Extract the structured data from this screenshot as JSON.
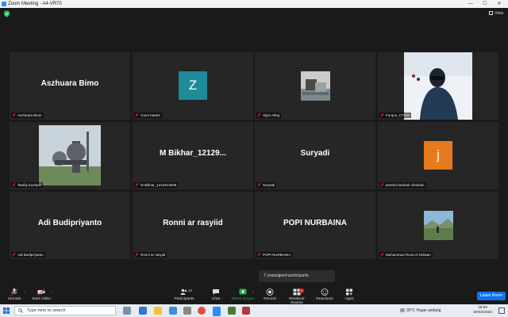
{
  "window": {
    "title": "Zoom Meeting - A4-VR70",
    "minimize": "—",
    "maximize": "☐",
    "close": "✕"
  },
  "header": {
    "view_label": "View"
  },
  "tiles": [
    {
      "name": "Aszhuara Bimo",
      "big_name": "Aszhuara Bimo"
    },
    {
      "name": "zoom baa04",
      "letter": "Z",
      "color": "#1e8a9a"
    },
    {
      "name": "Hijaz Alhaj"
    },
    {
      "name": "Furqon_CTW3"
    },
    {
      "name": "Taufiq Gusfadli"
    },
    {
      "name": "M Bikhar_1212913006",
      "big_name": "M  Bikhar_12129..."
    },
    {
      "name": "Suryadi",
      "big_name": "Suryadi"
    },
    {
      "name": "jeremia lambok christian",
      "letter": "j",
      "color": "#e8791c"
    },
    {
      "name": "Adi Budipriyanto",
      "big_name": "Adi Budipriyanto"
    },
    {
      "name": "Ronni ar rasyiid",
      "big_name": "Ronni ar rasyiid"
    },
    {
      "name": "POPI NURBAINA",
      "big_name": "POPI NURBAINA"
    },
    {
      "name": "Muhammad Reza Al Ridwan"
    }
  ],
  "popup": {
    "text": "7 unassigned participants"
  },
  "toolbar": {
    "unmute": "Unmute",
    "start_video": "Start Video",
    "participants": "Participants",
    "participants_count": "12",
    "chat": "Chat",
    "share_screen": "Share Screen",
    "record": "Record",
    "breakout_rooms": "Breakout Rooms",
    "breakout_badge": "7",
    "reactions": "Reactions",
    "apps": "Apps",
    "leave": "Leave Room"
  },
  "taskbar": {
    "search_placeholder": "Type here to search",
    "weather": "30°C  Hujan sedang",
    "time": "18:50",
    "date": "30/03/2022"
  },
  "colors": {
    "accent": "#0e72ed",
    "share_green": "#22b14c",
    "muted_red": "#e02828"
  }
}
